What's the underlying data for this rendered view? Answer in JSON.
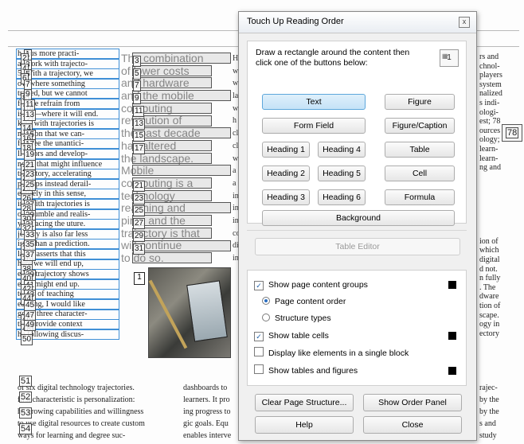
{
  "document": {
    "col1_lines": [
      "h  thus  more  practi-",
      "at work with trajecto-",
      "5. With a trajectory, we",
      "ow  where  something",
      "traded, but we cannot",
      "for  we  refrain  from",
      "ising—where it will end.",
      "king with trajectories is",
      "mission that we can-",
      "foresee the unantici-",
      "ll actors and develop-",
      "nents that might influence",
      "trajectory, accelerating",
      "perhaps instead derail-",
      "entirely in this sense,",
      "ing with trajectories is",
      "ore humble and realis-",
      "y of facing the uture.",
      "jectory is also far less",
      "istic than a prediction.",
      "latter asserts that this",
      "here we will end up,",
      "eas a trajectory shows",
      "e we might end up.",
      "terms of teaching",
      "earning, I would like",
      "ggest three character-",
      "that provide context",
      "he following discus-"
    ],
    "col2_lines": [
      "The combination",
      "of lower costs",
      "and hardware",
      "and the mobile",
      "computing",
      "revolution of",
      "the past decade",
      "has altered",
      "the landscape.",
      "Mobile",
      "computing is a",
      "technology",
      "reaching and",
      "ping, and the",
      "trajectory is that",
      "will continue",
      "to do so."
    ],
    "col3_letters": [
      "H",
      "w",
      "w",
      "la",
      "w",
      "h",
      "cl",
      "cl",
      "w",
      "a",
      "a",
      "in",
      "in",
      "in",
      "co",
      "di",
      "in"
    ],
    "col4_lines": [
      "rs and",
      "chnol-",
      "players",
      "system",
      "nalized",
      "s indi-",
      "ologi-",
      "est; 78",
      "ources",
      "ology;",
      "learn-",
      "learn-",
      "ng and",
      "",
      "",
      "",
      "",
      "",
      "",
      "",
      "ion of",
      "which",
      "digital",
      "d not.",
      "n fully",
      ". The",
      "dware",
      "tion of",
      "scape.",
      "ogy in",
      "ectory"
    ],
    "bottom_rows": [
      {
        "a": "of six digital technology trajectories.",
        "b": "dashboards to",
        "c": "rajec-"
      },
      {
        "a": "first characteristic is personalization:",
        "b": "learners. It pro",
        "c": "by the"
      },
      {
        "a": "he growing capabilities and willingness",
        "b": "ing progress to",
        "c": "by the"
      },
      {
        "a": "to use digital resources to create custom",
        "b": "gic goals. Equ",
        "c": "s and"
      },
      {
        "a": "ways for learning and degree suc-",
        "b": "enables interve",
        "c": "study"
      }
    ],
    "photo_number": "1"
  },
  "tags": {
    "col1_numbers": [
      "1",
      "2",
      "3",
      "4",
      "5",
      "6",
      "7",
      "8",
      "9",
      "10",
      "11",
      "12",
      "13",
      "14",
      "15",
      "16",
      "17",
      "18",
      "19",
      "20",
      "21",
      "22",
      "23",
      "24",
      "25",
      "26",
      "27",
      "28",
      "29",
      "30",
      "31",
      "32",
      "33",
      "34",
      "35",
      "36",
      "37",
      "38",
      "39",
      "40",
      "41",
      "42",
      "43",
      "44",
      "45",
      "46",
      "47",
      "48",
      "49",
      "50"
    ],
    "col2_numbers": [
      "3",
      "5",
      "7",
      "9",
      "11",
      "13",
      "15",
      "17",
      "21",
      "23",
      "25",
      "27",
      "29",
      "31"
    ],
    "col4_number": "78",
    "bottom_numbers": [
      "51",
      "52",
      "53",
      "54"
    ]
  },
  "dialog": {
    "title": "Touch Up Reading Order",
    "close_label": "x",
    "instruction": "Draw a rectangle around the content then click one of the buttons below:",
    "draw_icon_label": "1",
    "buttons": {
      "text": "Text",
      "figure": "Figure",
      "form_field": "Form Field",
      "figure_caption": "Figure/Caption",
      "heading1": "Heading 1",
      "heading4": "Heading 4",
      "table": "Table",
      "heading2": "Heading 2",
      "heading5": "Heading 5",
      "cell": "Cell",
      "heading3": "Heading 3",
      "heading6": "Heading 6",
      "formula": "Formula",
      "background": "Background",
      "table_editor": "Table Editor",
      "clear_page_structure": "Clear Page Structure...",
      "show_order_panel": "Show Order Panel",
      "help": "Help",
      "close": "Close"
    },
    "options": {
      "show_page_content_groups": "Show page content groups",
      "page_content_order": "Page content order",
      "structure_types": "Structure types",
      "show_table_cells": "Show table cells",
      "display_like_elements": "Display like elements in a single block",
      "show_tables_and_figures": "Show tables and figures"
    },
    "state": {
      "show_page_content_groups": true,
      "page_content_order": true,
      "structure_types": false,
      "show_table_cells": true,
      "display_like_elements": false,
      "show_tables_and_figures": false
    },
    "colors": {
      "content_groups_swatch": "#000000",
      "table_cells_swatch": "#000000",
      "tables_figures_swatch": "#000000",
      "tag_box_blue": "#3f8fd6"
    }
  }
}
